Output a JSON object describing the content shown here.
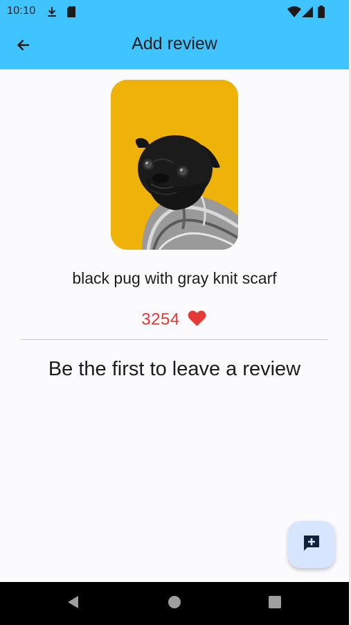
{
  "status_bar": {
    "time": "10:10",
    "left_icons": [
      "download-icon",
      "sd-card-icon"
    ],
    "right_icons": [
      "wifi-icon",
      "cell-signal-icon",
      "battery-icon"
    ]
  },
  "app_bar": {
    "title": "Add review",
    "back_icon": "arrow-back-icon",
    "color": "#40c4ff"
  },
  "item": {
    "photo_alt": "black pug with gray knit scarf",
    "photo_bg": "#eeb209",
    "caption": "black pug with gray knit scarf",
    "likes": "3254",
    "like_icon": "heart-icon",
    "like_color": "#e53935"
  },
  "reviews": {
    "empty_message": "Be the first to leave a review"
  },
  "fab": {
    "icon": "add-comment-icon",
    "color": "#d7e5ff"
  },
  "nav_bar": {
    "icons": [
      "back-triangle-icon",
      "home-circle-icon",
      "recents-square-icon"
    ]
  }
}
